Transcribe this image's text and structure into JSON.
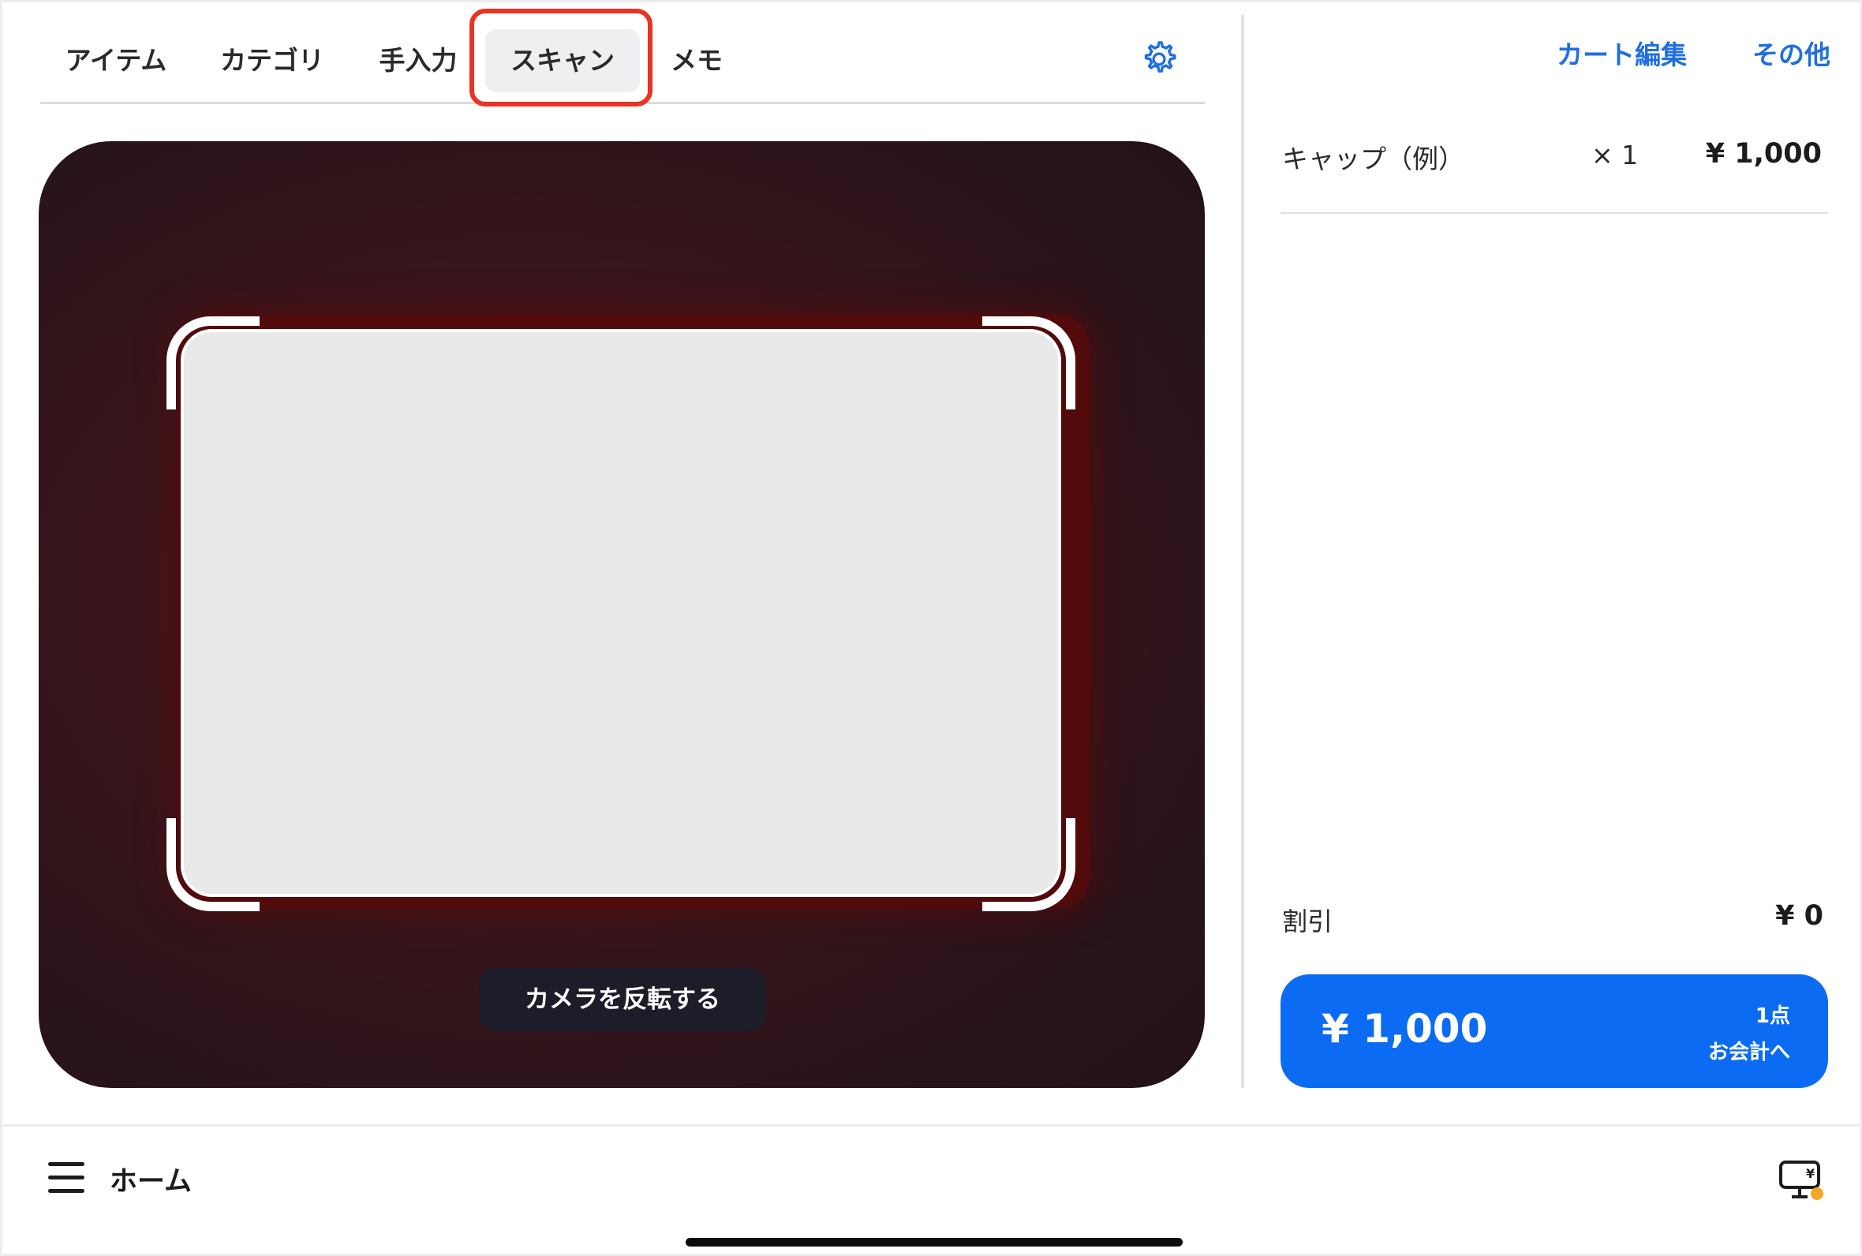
{
  "tabs": [
    {
      "label": "アイテム"
    },
    {
      "label": "カテゴリ"
    },
    {
      "label": "手入力"
    },
    {
      "label": "スキャン"
    },
    {
      "label": "メモ"
    }
  ],
  "active_tab": "スキャン",
  "camera": {
    "flip_label": "カメラを反転する"
  },
  "header": {
    "edit_cart_label": "カート編集",
    "other_label": "その他"
  },
  "cart": {
    "items": [
      {
        "name": "キャップ（例）",
        "qty": "× 1",
        "price": "¥ 1,000"
      }
    ],
    "discount_label": "割引",
    "discount_value": "¥ 0"
  },
  "checkout": {
    "total": "¥ 1,000",
    "count": "1点",
    "label": "お会計へ"
  },
  "bottom": {
    "home_label": "ホーム"
  },
  "icons": {
    "settings": "gear-icon",
    "menu": "hamburger-menu-icon",
    "customer_display": "display-yen-icon"
  },
  "colors": {
    "accent": "#0b6cf3",
    "link": "#1f6fe0",
    "highlight": "#ea3323",
    "status_dot": "#f5a623"
  }
}
